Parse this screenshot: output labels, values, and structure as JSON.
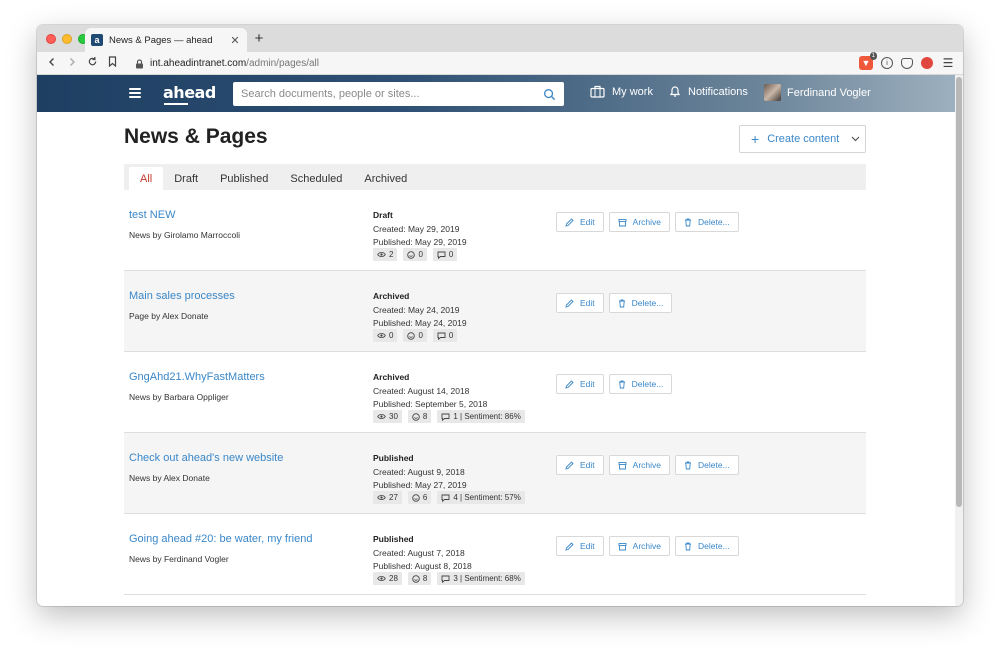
{
  "browser": {
    "tab_title": "News & Pages — ahead",
    "url_host": "int.aheadintranet.com",
    "url_path": "/admin/pages/all",
    "brave_badge": "1"
  },
  "header": {
    "logo": "ahead",
    "search_placeholder": "Search documents, people or sites...",
    "my_work": "My work",
    "notifications": "Notifications",
    "user_name": "Ferdinand Vogler"
  },
  "page": {
    "title": "News & Pages",
    "create_label": "Create content",
    "tabs": [
      "All",
      "Draft",
      "Published",
      "Scheduled",
      "Archived"
    ],
    "active_tab": "All"
  },
  "actions": {
    "edit": "Edit",
    "archive": "Archive",
    "delete": "Delete..."
  },
  "rows": [
    {
      "title": "test NEW",
      "meta": "News by Girolamo Marroccoli",
      "status": "Draft",
      "created": "Created: May 29, 2019",
      "published": "Published: May 29, 2019",
      "views": "2",
      "reactions": "0",
      "comments": "0",
      "archive": true
    },
    {
      "title": "Main sales processes",
      "meta": "Page by Alex Donate",
      "status": "Archived",
      "created": "Created: May 24, 2019",
      "published": "Published: May 24, 2019",
      "views": "0",
      "reactions": "0",
      "comments": "0",
      "archive": false
    },
    {
      "title": "GngAhd21.WhyFastMatters",
      "meta": "News by Barbara Oppliger",
      "status": "Archived",
      "created": "Created: August 14, 2018",
      "published": "Published: September 5, 2018",
      "views": "30",
      "reactions": "8",
      "comments": "1 | Sentiment: 86%",
      "archive": false
    },
    {
      "title": "Check out ahead's new website",
      "meta": "News by Alex Donate",
      "status": "Published",
      "created": "Created: August 9, 2018",
      "published": "Published: May 27, 2019",
      "views": "27",
      "reactions": "6",
      "comments": "4 | Sentiment: 57%",
      "archive": true
    },
    {
      "title": "Going ahead #20: be water, my friend",
      "meta": "News by Ferdinand Vogler",
      "status": "Published",
      "created": "Created: August 7, 2018",
      "published": "Published: August 8, 2018",
      "views": "28",
      "reactions": "8",
      "comments": "3 | Sentiment: 68%",
      "archive": true
    }
  ],
  "colors": {
    "link": "#3a87c8",
    "active_tab": "#c0392b",
    "header_start": "#1e3f62",
    "header_end": "#9db0bf"
  }
}
